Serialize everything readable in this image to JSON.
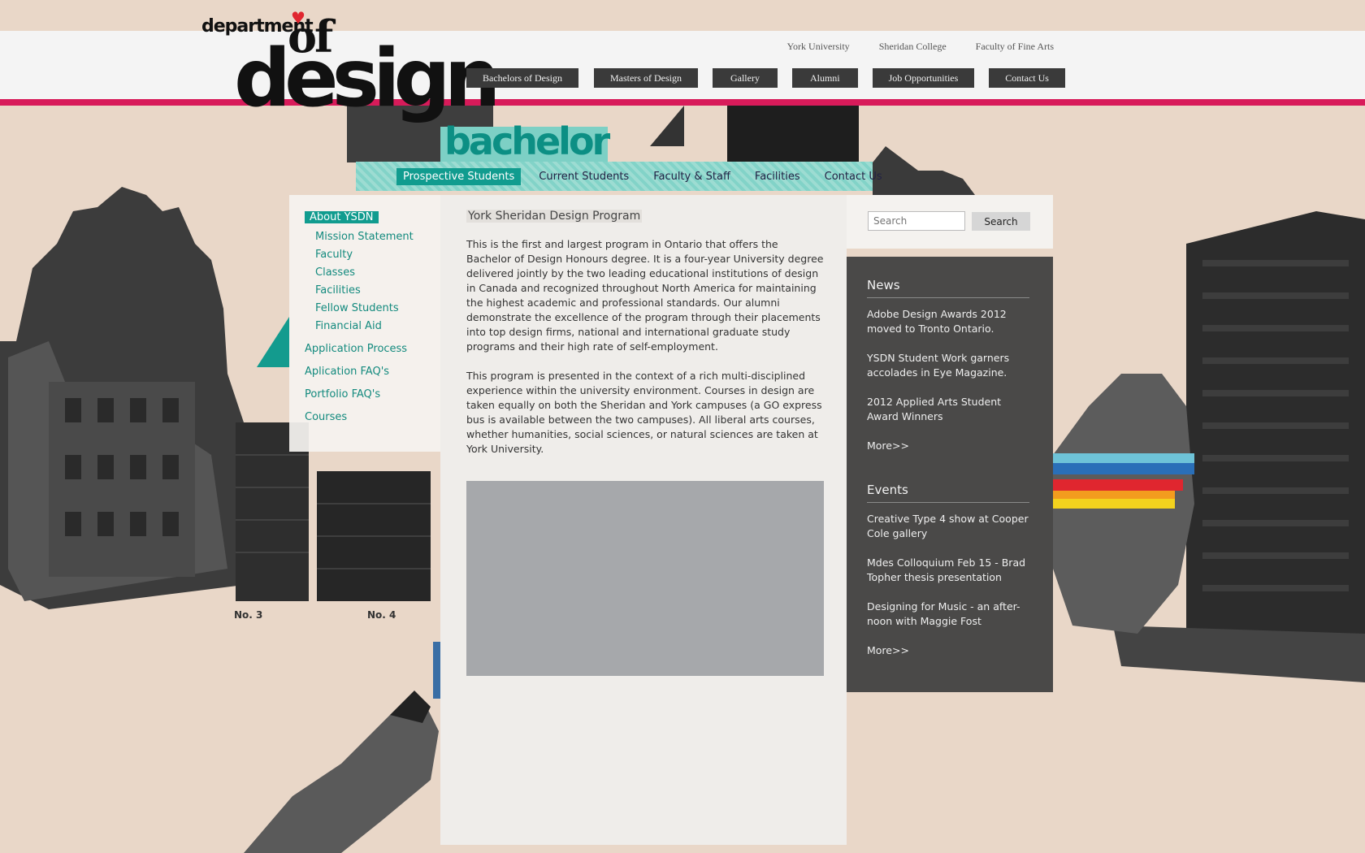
{
  "logo": {
    "small": "department",
    "of": "of",
    "big": "design",
    "heart": "♥"
  },
  "utility_links": [
    "York University",
    "Sheridan College",
    "Faculty of Fine Arts"
  ],
  "main_nav": [
    "Bachelors of Design",
    "Masters of Design",
    "Gallery",
    "Alumni",
    "Job Opportunities",
    "Contact Us"
  ],
  "section_title": "bachelor",
  "sub_nav": {
    "items": [
      "Prospective Students",
      "Current Students",
      "Faculty & Staff",
      "Facilities",
      "Contact Us"
    ],
    "active": "Prospective Students"
  },
  "sidebar": {
    "about": "About YSDN",
    "sub_items": [
      "Mission Statement",
      "Faculty",
      "Classes",
      "Facilities",
      "Fellow Students",
      "Financial Aid"
    ],
    "items": [
      "Application Process",
      "Aplication FAQ's",
      "Portfolio FAQ's",
      "Courses"
    ]
  },
  "main": {
    "title": "York Sheridan Design Program",
    "paragraphs": [
      "This is the first and largest program in Ontario that offers the Bachelor of Design Honours degree. It is a four-year University degree delivered jointly by the two leading educational institutions of design in Canada and recognized throughout North America for maintaining the highest academic and professional standards. Our alumni demonstrate the excellence of the program through their placements into top design firms, national and international graduate study programs and their high rate of self-employment.",
      "This program is presented in the context of a rich multi-disciplined experience within the university environment. Courses in design are taken equally on both the Sheridan and York campuses (a GO express bus is available between the two campuses). All liberal arts courses, whether humanities, social sciences, or natural sciences are taken at York University."
    ]
  },
  "search": {
    "placeholder": "Search",
    "button": "Search"
  },
  "news": {
    "heading": "News",
    "items": [
      "Adobe Design Awards 2012 moved to Tronto Ontario.",
      "YSDN Student Work garners accolades in Eye Magazine.",
      "2012 Applied Arts Student Award Winners"
    ],
    "more": "More>>"
  },
  "events": {
    "heading": "Events",
    "items": [
      "Creative Type 4 show at Cooper Cole gallery",
      "Mdes Colloquium Feb 15 - Brad Topher thesis presentation",
      "Designing for Music - an after-noon with Maggie Fost"
    ],
    "more": "More>>"
  },
  "collage": {
    "label_no3": "No. 3",
    "label_no4": "No. 4"
  },
  "colors": {
    "accent_pink": "#d81b5a",
    "teal": "#119c8f",
    "teal_light": "#7dd0c5",
    "nav_dark": "#3a3a3a",
    "background": "#e9d7c8"
  }
}
